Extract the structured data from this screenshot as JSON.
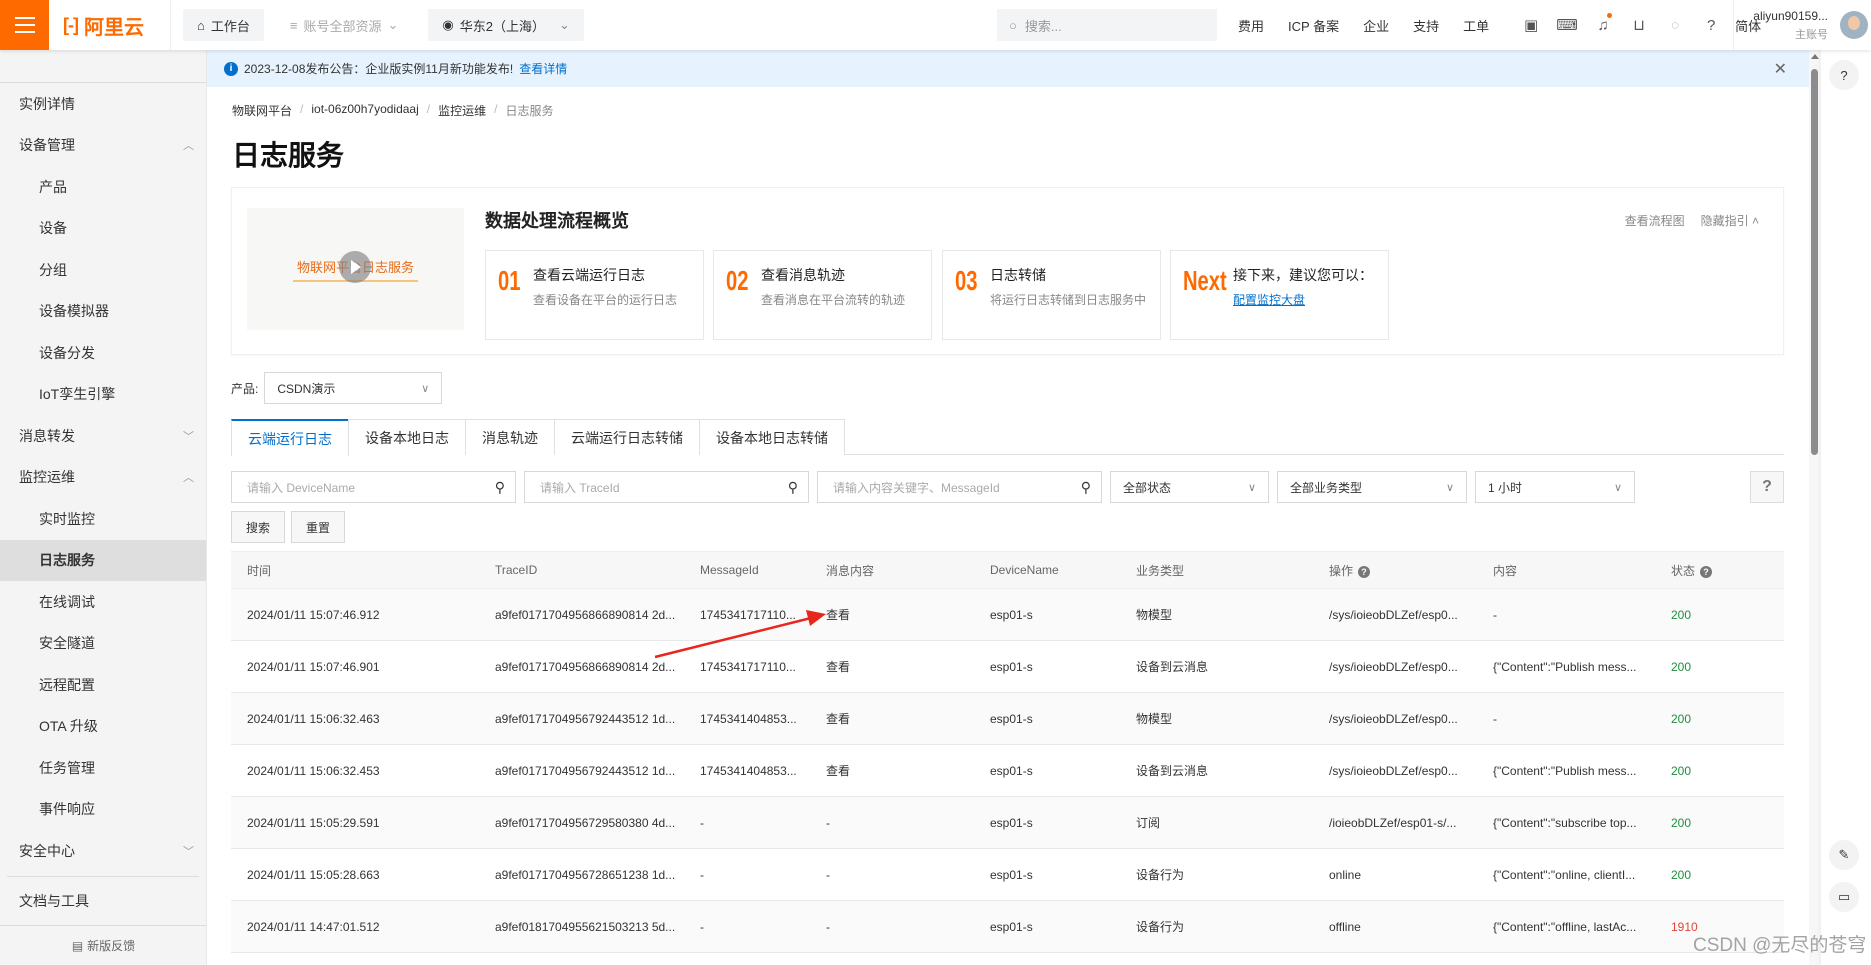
{
  "header": {
    "brand": "阿里云",
    "workbench": "工作台",
    "resources": "账号全部资源",
    "region": "华东2（上海）",
    "search_placeholder": "搜索...",
    "nav": [
      "费用",
      "ICP 备案",
      "企业",
      "支持",
      "工单"
    ],
    "icons": [
      "app-icon",
      "terminal-icon",
      "bell-icon",
      "cart-icon",
      "bulb-icon",
      "help-icon"
    ],
    "language": "简体",
    "account_name": "aliyun90159...",
    "account_role": "主账号"
  },
  "sidebar": {
    "items": [
      {
        "label": "实例详情",
        "level": 1
      },
      {
        "label": "设备管理",
        "level": 1,
        "chevron": "up"
      },
      {
        "label": "产品",
        "level": 2
      },
      {
        "label": "设备",
        "level": 2
      },
      {
        "label": "分组",
        "level": 2
      },
      {
        "label": "设备模拟器",
        "level": 2
      },
      {
        "label": "设备分发",
        "level": 2
      },
      {
        "label": "IoT孪生引擎",
        "level": 2
      },
      {
        "label": "消息转发",
        "level": 1,
        "chevron": "down"
      },
      {
        "label": "监控运维",
        "level": 1,
        "chevron": "up"
      },
      {
        "label": "实时监控",
        "level": 2
      },
      {
        "label": "日志服务",
        "level": 2,
        "active": true
      },
      {
        "label": "在线调试",
        "level": 2
      },
      {
        "label": "安全隧道",
        "level": 2
      },
      {
        "label": "远程配置",
        "level": 2
      },
      {
        "label": "OTA 升级",
        "level": 2
      },
      {
        "label": "任务管理",
        "level": 2
      },
      {
        "label": "事件响应",
        "level": 2
      },
      {
        "label": "安全中心",
        "level": 1,
        "chevron": "down"
      }
    ],
    "docs": "文档与工具",
    "feedback": "新版反馈"
  },
  "notice": {
    "text": "2023-12-08发布公告：企业版实例11月新功能发布!",
    "link": "查看详情"
  },
  "breadcrumb": [
    "物联网平台",
    "iot-06z00h7yodidaaj",
    "监控运维",
    "日志服务"
  ],
  "page_title": "日志服务",
  "guide": {
    "video_title": "物联网平台日志服务",
    "title": "数据处理流程概览",
    "view_flow": "查看流程图",
    "hide_guide": "隐藏指引",
    "steps": [
      {
        "num": "01",
        "title": "查看云端运行日志",
        "desc": "查看设备在平台的运行日志"
      },
      {
        "num": "02",
        "title": "查看消息轨迹",
        "desc": "查看消息在平台流转的轨迹"
      },
      {
        "num": "03",
        "title": "日志转储",
        "desc": "将运行日志转储到日志服务中"
      },
      {
        "num": "Next",
        "title": "接下来，建议您可以：",
        "desc": "配置监控大盘"
      }
    ]
  },
  "product": {
    "label": "产品:",
    "value": "CSDN演示"
  },
  "tabs": [
    "云端运行日志",
    "设备本地日志",
    "消息轨迹",
    "云端运行日志转储",
    "设备本地日志转储"
  ],
  "filters": {
    "device_placeholder": "请输入 DeviceName",
    "trace_placeholder": "请输入 TraceId",
    "content_placeholder": "请输入内容关键字、MessageId",
    "status": "全部状态",
    "biz_type": "全部业务类型",
    "time_range": "1 小时",
    "help": "?",
    "search": "搜索",
    "reset": "重置"
  },
  "table": {
    "columns": [
      "时间",
      "TraceID",
      "MessageId",
      "消息内容",
      "DeviceName",
      "业务类型",
      "操作",
      "内容",
      "状态"
    ],
    "rows": [
      {
        "time": "2024/01/11 15:07:46.912",
        "trace": "a9fef0171704956866890814 2d...",
        "msgid": "1745341717110...",
        "content_link": "查看",
        "device": "esp01-s",
        "biz": "物模型",
        "op": "/sys/ioieobDLZef/esp0...",
        "body": "-",
        "status": "200"
      },
      {
        "time": "2024/01/11 15:07:46.901",
        "trace": "a9fef0171704956866890814 2d...",
        "msgid": "1745341717110...",
        "content_link": "查看",
        "device": "esp01-s",
        "biz": "设备到云消息",
        "op": "/sys/ioieobDLZef/esp0...",
        "body": "{\"Content\":\"Publish mess...",
        "status": "200"
      },
      {
        "time": "2024/01/11 15:06:32.463",
        "trace": "a9fef0171704956792443512 1d...",
        "msgid": "1745341404853...",
        "content_link": "查看",
        "device": "esp01-s",
        "biz": "物模型",
        "op": "/sys/ioieobDLZef/esp0...",
        "body": "-",
        "status": "200"
      },
      {
        "time": "2024/01/11 15:06:32.453",
        "trace": "a9fef0171704956792443512 1d...",
        "msgid": "1745341404853...",
        "content_link": "查看",
        "device": "esp01-s",
        "biz": "设备到云消息",
        "op": "/sys/ioieobDLZef/esp0...",
        "body": "{\"Content\":\"Publish mess...",
        "status": "200"
      },
      {
        "time": "2024/01/11 15:05:29.591",
        "trace": "a9fef0171704956729580380 4d...",
        "msgid": "-",
        "content_link": "-",
        "device": "esp01-s",
        "biz": "订阅",
        "op": "/ioieobDLZef/esp01-s/...",
        "body": "{\"Content\":\"subscribe top...",
        "status": "200"
      },
      {
        "time": "2024/01/11 15:05:28.663",
        "trace": "a9fef0171704956728651238 1d...",
        "msgid": "-",
        "content_link": "-",
        "device": "esp01-s",
        "biz": "设备行为",
        "op": "online",
        "body": "{\"Content\":\"online, clientI...",
        "status": "200"
      },
      {
        "time": "2024/01/11 14:47:01.512",
        "trace": "a9fef0181704955621503213 5d...",
        "msgid": "-",
        "content_link": "-",
        "device": "esp01-s",
        "biz": "设备行为",
        "op": "offline",
        "body": "{\"Content\":\"offline, lastAc...",
        "status": "1910"
      }
    ]
  },
  "colors": {
    "brand": "#ff6a00",
    "link": "#0070cc",
    "ok": "#1e8e3e",
    "error": "#e0463b",
    "annotation_arrow": "#e8261c"
  },
  "watermark": "CSDN @无尽的苍穹"
}
